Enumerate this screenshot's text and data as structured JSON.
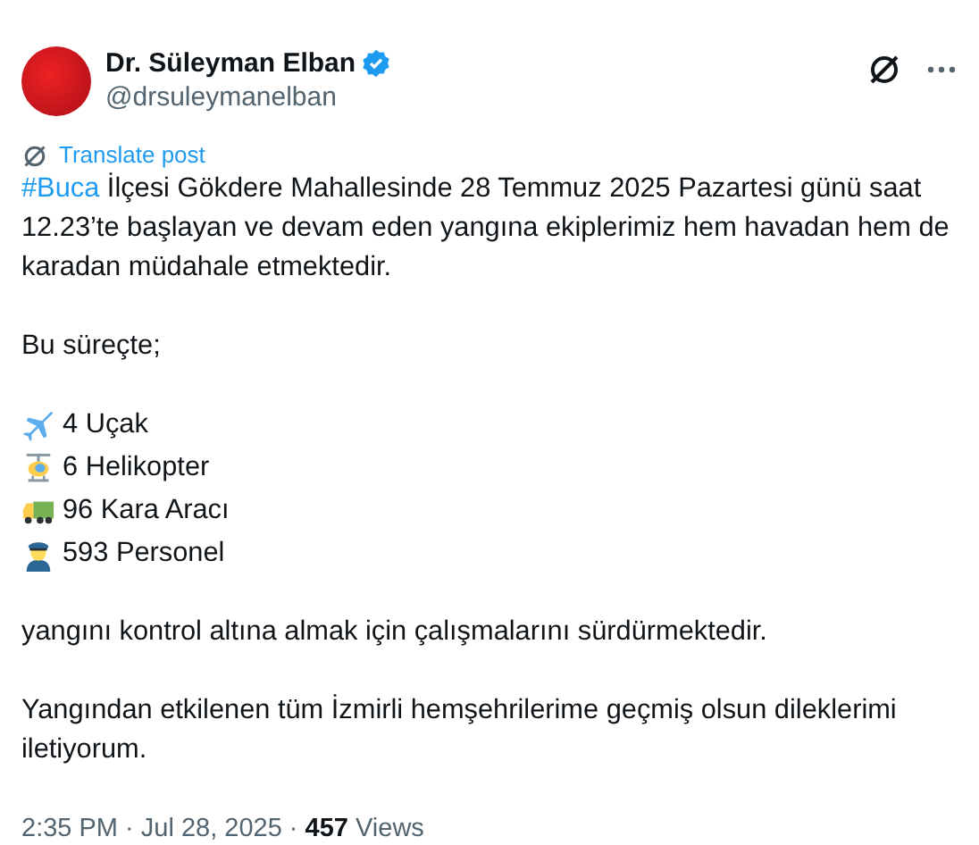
{
  "author": {
    "name": "Dr. Süleyman Elban",
    "verified": true,
    "handle": "@drsuleymanelban"
  },
  "translate": "Translate post",
  "intro": {
    "hashtag": "#Buca",
    "text": " İlçesi Gökdere Mahallesinde 28 Temmuz 2025 Pazartesi günü saat 12.23’te başlayan ve devam eden yangına ekiplerimiz hem havadan hem de karadan müdahale etmektedir."
  },
  "lead": "Bu süreçte;",
  "resources": [
    {
      "kind": "plane",
      "text": "4 Uçak"
    },
    {
      "kind": "helicopter",
      "text": "6 Helikopter"
    },
    {
      "kind": "truck",
      "text": "96 Kara Aracı"
    },
    {
      "kind": "officer",
      "text": "593 Personel"
    }
  ],
  "paragraphs": [
    "yangını kontrol altına almak için çalışmalarını sürdürmektedir.",
    "Yangından etkilenen tüm İzmirli hemşehrilerime geçmiş olsun dileklerimi iletiyorum."
  ],
  "footer": "2:35 PM · Jul 28, 2025 · **457** Views"
}
